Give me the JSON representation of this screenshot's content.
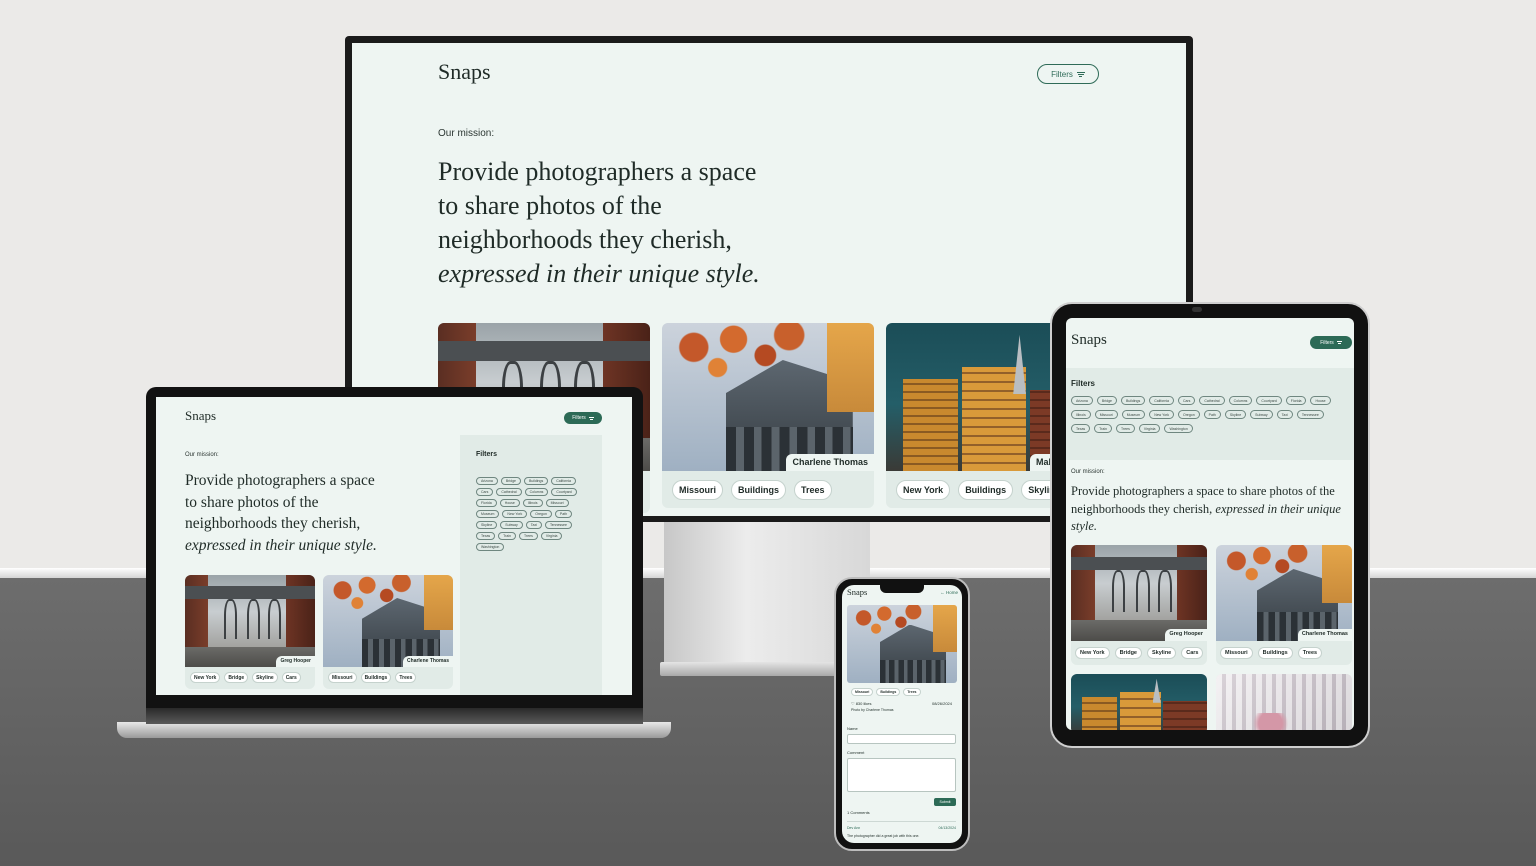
{
  "app": {
    "logo": "Snaps",
    "filters_label": "Filters",
    "mission_label": "Our mission:",
    "mission_line1": "Provide photographers a space",
    "mission_line2": "to share photos of the",
    "mission_line3": "neighborhoods they cherish,",
    "mission_italic": "expressed in their unique style.",
    "mission_tablet_plain": "Provide photographers a space to share photos of the neighborhoods they cherish,",
    "mission_tablet_italic": "expressed in their unique style."
  },
  "colors": {
    "accent": "#2c6a56",
    "screen_bg": "#eef5f2",
    "card_bg": "#e1ebe7"
  },
  "cards": [
    {
      "credit": "Greg Hooper",
      "tags": [
        "New York",
        "Bridge",
        "Skyline",
        "Cars"
      ]
    },
    {
      "credit": "Charlene Thomas",
      "tags": [
        "Missouri",
        "Buildings",
        "Trees"
      ]
    },
    {
      "credit": "Mal",
      "tags": [
        "New York",
        "Buildings",
        "Skyline"
      ]
    }
  ],
  "filter_chips": [
    "Arizona",
    "Bridge",
    "Buildings",
    "California",
    "Cars",
    "Cathedral",
    "Columns",
    "Courtyard",
    "Florida",
    "House",
    "Illinois",
    "Missouri",
    "Museum",
    "New York",
    "Oregon",
    "Path",
    "Skyline",
    "Subway",
    "Taxi",
    "Tennessee",
    "Texas",
    "Train",
    "Trees",
    "Virginia",
    "Washington"
  ],
  "laptop_chips": [
    "Arizona",
    "Bridge",
    "Buildings",
    "California",
    "Cars",
    "Cathedral",
    "Columns",
    "Courtyard",
    "Florida",
    "House",
    "Illinois",
    "Missouri",
    "Museum",
    "New York",
    "Oregon",
    "Path",
    "Skyline",
    "Subway",
    "Taxi",
    "Tennessee",
    "Texas",
    "Train",
    "Trees",
    "Virginia",
    "Washington"
  ],
  "phone": {
    "logo": "Snaps",
    "nav_home": "← Home",
    "tags": [
      "Missouri",
      "Buildings",
      "Trees"
    ],
    "likes": "♡ 830 likes",
    "date": "08/26/2024",
    "photo_by": "Photo by Charlene Thomas",
    "name_label": "Name",
    "comment_label": "Comment",
    "submit": "Submit",
    "comments_heading": "1 Comments",
    "commenter": "Dev Ann",
    "comment_date": "04/13/2024",
    "comment_text": "The photographer did a great job with this one."
  }
}
